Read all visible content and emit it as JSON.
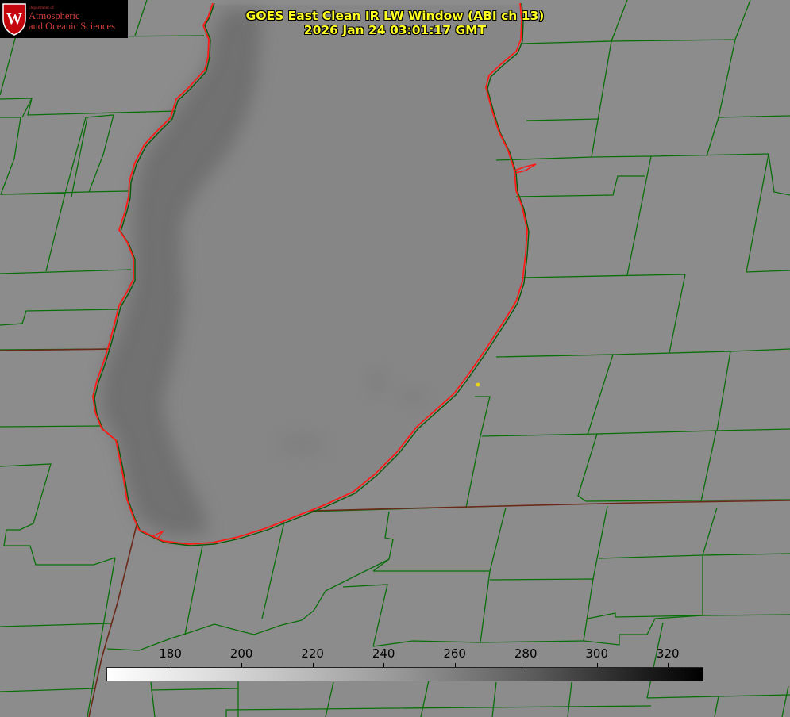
{
  "title": {
    "line1": "GOES East Clean IR LW Window (ABI ch 13)",
    "line2": "2026 Jan 24 03:01:17 GMT"
  },
  "logo": {
    "department": "Department of",
    "line1": "Atmospheric",
    "line2": "and Oceanic Sciences",
    "seal_letter": "W"
  },
  "colorbar": {
    "ticks": [
      "180",
      "200",
      "220",
      "240",
      "260",
      "280",
      "300",
      "320"
    ],
    "tick_values": [
      180,
      200,
      220,
      240,
      260,
      280,
      300,
      320
    ],
    "min": 162,
    "max": 330,
    "color_low": "#ffffff",
    "color_high": "#000000"
  },
  "colors": {
    "land_background": "#8c8c8c",
    "lake_fill": "#858585",
    "lake_cold_band": "#6e6e6e",
    "county_lines": "#0a6e0a",
    "coastline": "#ff1a1a",
    "title_text": "#ffff22",
    "marker": "#e6d21e"
  }
}
